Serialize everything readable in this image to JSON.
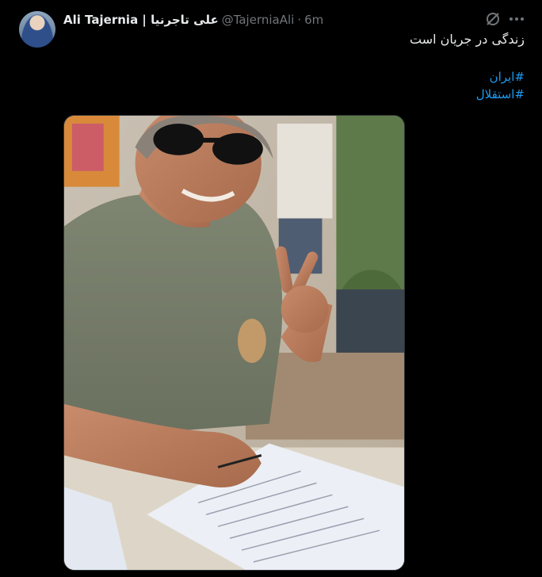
{
  "tweet": {
    "author": {
      "display_name": "Ali Tajernia | علی تاجرنیا",
      "handle": "@TajerniaAli",
      "separator": "·",
      "time": "6m"
    },
    "text": "زندگی در جریان است",
    "hashtags": [
      "#ایران",
      "#استقلال"
    ],
    "icons": {
      "grok": "grok-slash-icon",
      "more": "more-dots-icon"
    },
    "media": {
      "description_icon": "photo"
    }
  },
  "colors": {
    "background": "#000000",
    "text": "#e7e9ea",
    "muted": "#71767b",
    "link": "#1d9bf0"
  }
}
